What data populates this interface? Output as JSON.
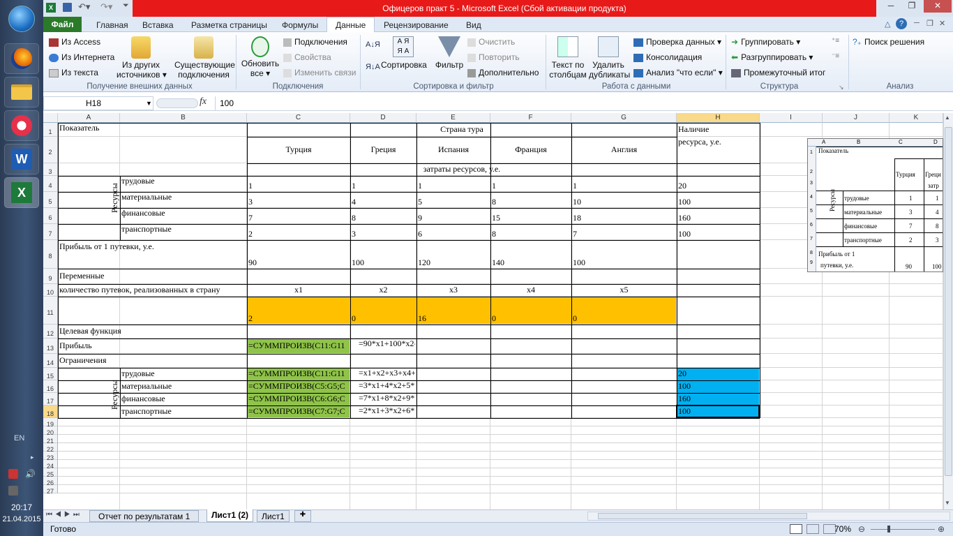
{
  "taskbar": {
    "lang": "EN",
    "time": "20:17",
    "date": "21.04.2015"
  },
  "window": {
    "title": "Офицеров практ 5  -  Microsoft Excel (Сбой активации продукта)"
  },
  "tabs": {
    "file": "Файл",
    "home": "Главная",
    "insert": "Вставка",
    "layout": "Разметка страницы",
    "formulas": "Формулы",
    "data": "Данные",
    "review": "Рецензирование",
    "view": "Вид"
  },
  "ribbon": {
    "ext": {
      "access": "Из Access",
      "web": "Из Интернета",
      "text": "Из текста",
      "other1": "Из других",
      "other2": "источников",
      "existing1": "Существующие",
      "existing2": "подключения",
      "group": "Получение внешних данных"
    },
    "conn": {
      "refresh1": "Обновить",
      "refresh2": "все",
      "connections": "Подключения",
      "properties": "Свойства",
      "editlinks": "Изменить связи",
      "group": "Подключения"
    },
    "sort": {
      "sort": "Сортировка",
      "filter": "Фильтр",
      "clear": "Очистить",
      "reapply": "Повторить",
      "advanced": "Дополнительно",
      "group": "Сортировка и фильтр"
    },
    "tools": {
      "text1": "Текст по",
      "text2": "столбцам",
      "dup1": "Удалить",
      "dup2": "дубликаты",
      "validation": "Проверка данных",
      "consolidate": "Консолидация",
      "whatif": "Анализ \"что если\"",
      "group": "Работа с данными"
    },
    "outline": {
      "group_btn": "Группировать",
      "ungroup": "Разгруппировать",
      "subtotal": "Промежуточный итог",
      "group": "Структура"
    },
    "analysis": {
      "solver": "Поиск решения",
      "group": "Анализ"
    }
  },
  "formula_bar": {
    "name_box": "H18",
    "fx": "fx",
    "value": "100"
  },
  "columns": [
    "A",
    "B",
    "C",
    "D",
    "E",
    "F",
    "G",
    "H",
    "I",
    "J",
    "K"
  ],
  "rows": [
    "1",
    "2",
    "3",
    "4",
    "5",
    "6",
    "7",
    "8",
    "9",
    "10",
    "11",
    "12",
    "13",
    "14",
    "15",
    "16",
    "17",
    "18",
    "19",
    "20",
    "21",
    "22",
    "23",
    "24",
    "25",
    "26",
    "27"
  ],
  "cells": {
    "a1": "Показатель",
    "country": "Страна тура",
    "avail1": "Наличие",
    "avail2": "ресурса, у.е.",
    "turkey": "Турция",
    "greece": "Греция",
    "spain": "Испания",
    "france": "Франция",
    "england": "Англия",
    "costs": "затраты ресурсов, у.е.",
    "resources": "Ресурсы",
    "labor": "трудовые",
    "material": "материальные",
    "financial": "финансовые",
    "transport": "транспортные",
    "r4": [
      "1",
      "1",
      "1",
      "1",
      "1",
      "20"
    ],
    "r5": [
      "3",
      "4",
      "5",
      "8",
      "10",
      "100"
    ],
    "r6": [
      "7",
      "8",
      "9",
      "15",
      "18",
      "160"
    ],
    "r7": [
      "2",
      "3",
      "6",
      "8",
      "7",
      "100"
    ],
    "profit_label": "Прибыль от 1 путевки, у.е.",
    "r8": [
      "90",
      "100",
      "120",
      "140",
      "100"
    ],
    "vars": "Переменные",
    "count_label": "количество путевок, реализованных в  страну",
    "x": [
      "x1",
      "x2",
      "x3",
      "x4",
      "x5"
    ],
    "r11": [
      "2",
      "0",
      "16",
      "0",
      "0"
    ],
    "goal": "Целевая функция",
    "profit": "Прибыль",
    "c13": "=СУММПРОИЗВ(C11:G11",
    "d13": "=90*x1+100*x2-",
    "limits": "Ограничения",
    "c15": "=СУММПРОИЗВ(C11:G11",
    "d15": "=x1+x2+x3+x4+x",
    "h15": "20",
    "c16": "=СУММПРОИЗВ(C5:G5;C",
    "d16": "=3*x1+4*x2+5*",
    "h16": "100",
    "c17": "=СУММПРОИЗВ(C6:G6;C",
    "d17": "=7*x1+8*x2+9*",
    "h17": "160",
    "c18": "=СУММПРОИЗВ(C7:G7;C",
    "d18": "=2*x1+3*x2+6*",
    "h18": "100"
  },
  "preview": {
    "cols": [
      "A",
      "B",
      "C",
      "D"
    ],
    "rows": [
      "1",
      "2",
      "3",
      "4",
      "5",
      "6",
      "7",
      "8",
      "9"
    ],
    "a1": "Показатель",
    "turkey": "Турция",
    "greece": "Греци",
    "costs": "затр",
    "res": "Ресурсы",
    "labor": "трудовые",
    "material": "материальные",
    "financial": "финансовые",
    "transport": "транспортные",
    "v": [
      [
        "1",
        "1"
      ],
      [
        "3",
        "4"
      ],
      [
        "7",
        "8"
      ],
      [
        "2",
        "3"
      ]
    ],
    "profit1": "Прибыль от 1",
    "profit2": "путевки, у.е.",
    "p": [
      "90",
      "100"
    ]
  },
  "sheets": {
    "s1": "Отчет по результатам 1",
    "s2": "Лист1 (2)",
    "s3": "Лист1"
  },
  "status": {
    "ready": "Готово",
    "zoom": "70%"
  }
}
